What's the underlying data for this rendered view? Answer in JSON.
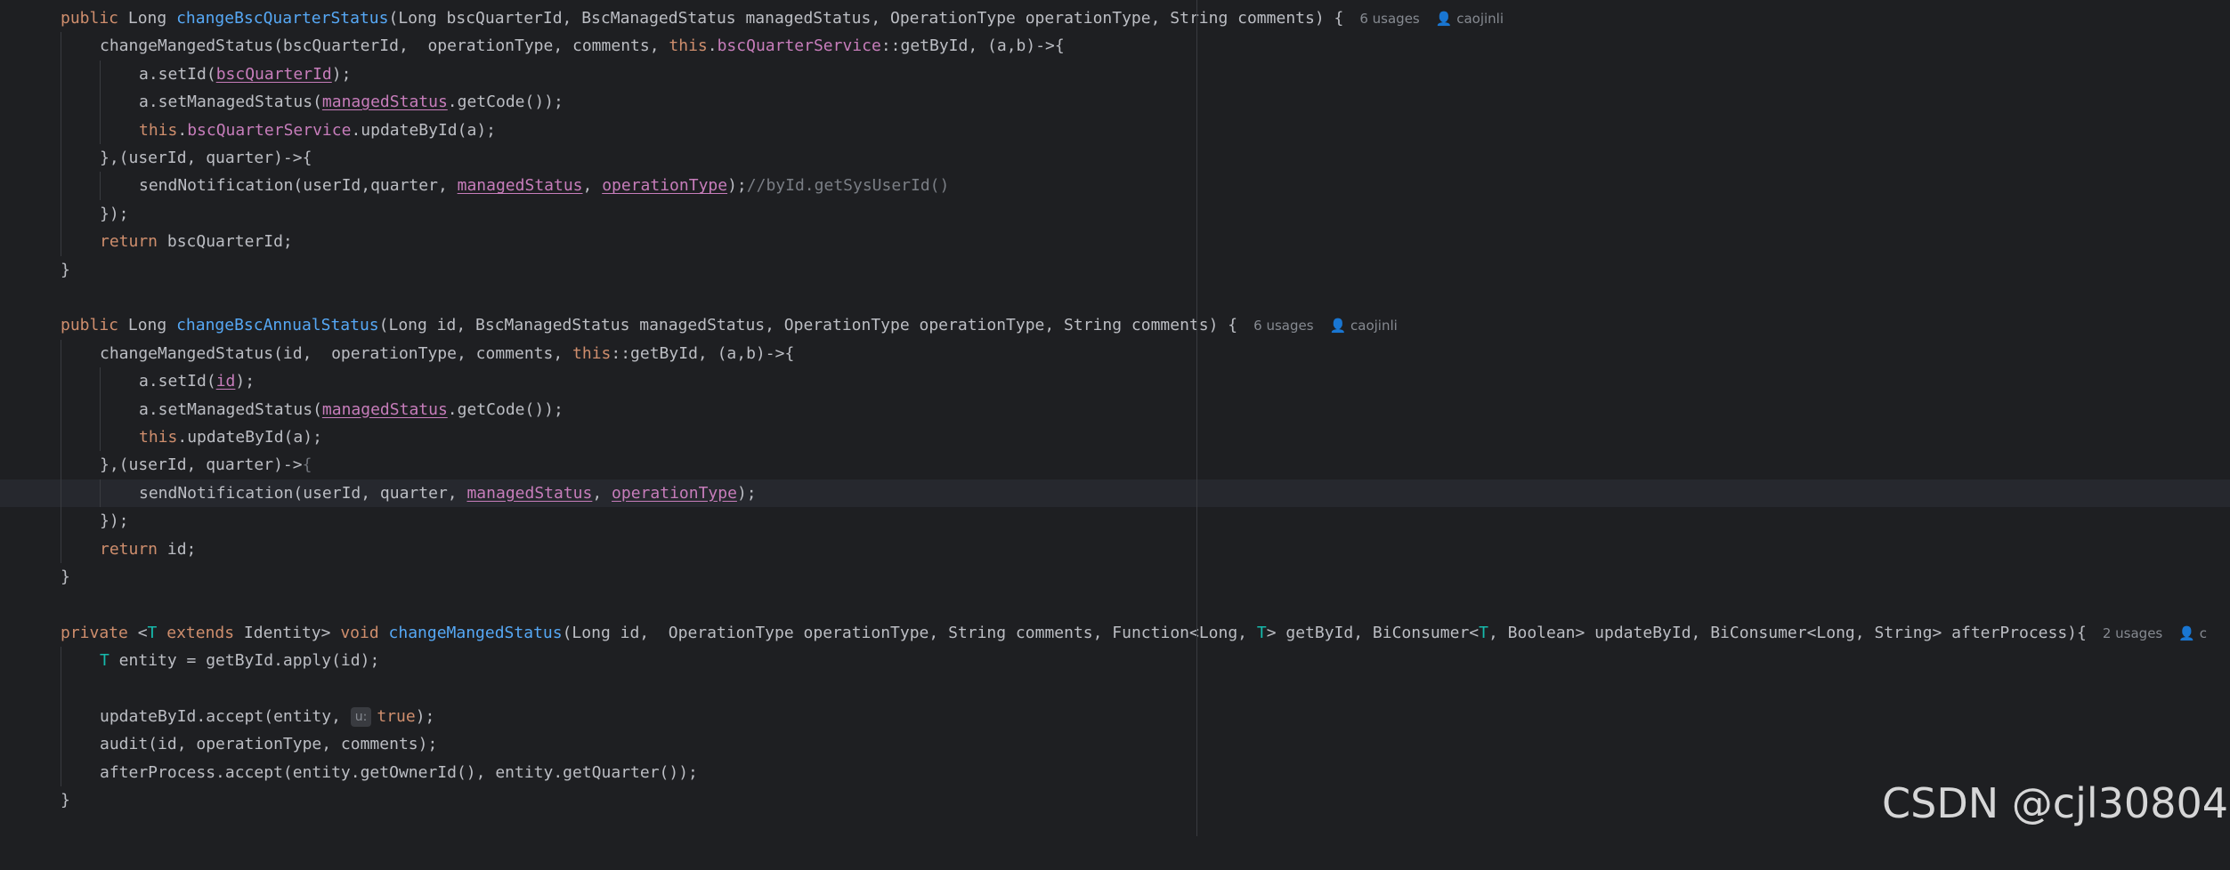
{
  "hints": {
    "usages_6": "6 usages",
    "usages_2": "2 usages",
    "author": "caojinli",
    "author_trunc": "c",
    "person_glyph": "👤"
  },
  "inlay_hint": "u:",
  "watermark": "CSDN @cjl30804",
  "colors": {
    "background": "#1e1f22",
    "keyword": "#cf8e6d",
    "function": "#56a8f5",
    "field": "#c77dbb",
    "type_param": "#16baac",
    "comment": "#7a7e85",
    "text": "#bcbec4"
  },
  "code": {
    "l0": {
      "a": "public",
      "b": " Long ",
      "c": "changeBscQuarterStatus",
      "d": "(Long bscQuarterId, BscManagedStatus managedStatus, OperationType operationType, String comments) {"
    },
    "l1": {
      "a": "changeMangedStatus(bscQuarterId,  operationType, comments, ",
      "b": "this",
      "c": ".",
      "d": "bscQuarterService",
      "e": "::getById, (a,b)->{"
    },
    "l2": {
      "a": "a.setId(",
      "b": "bscQuarterId",
      "c": ");"
    },
    "l3": {
      "a": "a.setManagedStatus(",
      "b": "managedStatus",
      "c": ".getCode());"
    },
    "l4": {
      "a": "this",
      "b": ".",
      "c": "bscQuarterService",
      "d": ".updateById(a);"
    },
    "l5": {
      "a": "},(userId, quarter)->{"
    },
    "l6": {
      "a": "sendNotification(userId,quarter, ",
      "b": "managedStatus",
      "c": ", ",
      "d": "operationType",
      "e": ");",
      "f": "//byId.getSysUserId()"
    },
    "l7": {
      "a": "});"
    },
    "l8": {
      "a": "return",
      "b": " bscQuarterId;"
    },
    "l9": {
      "a": "}"
    },
    "l11": {
      "a": "public",
      "b": " Long ",
      "c": "changeBscAnnualStatus",
      "d": "(Long id, BscManagedStatus managedStatus, OperationType operationType, String comments) {"
    },
    "l12": {
      "a": "changeMangedStatus(id,  operationType, comments, ",
      "b": "this",
      "c": "::getById, (a,b)->{"
    },
    "l13": {
      "a": "a.setId(",
      "b": "id",
      "c": ");"
    },
    "l14": {
      "a": "a.setManagedStatus(",
      "b": "managedStatus",
      "c": ".getCode());"
    },
    "l15": {
      "a": "this",
      "b": ".updateById(a);"
    },
    "l16": {
      "a": "},(userId, quarter)->",
      "b": "{"
    },
    "l17": {
      "a": "sendNotification(userId, quarter, ",
      "b": "managedStatus",
      "c": ", ",
      "d": "operationType",
      "e": ");"
    },
    "l18": {
      "a": "});"
    },
    "l19": {
      "a": "return",
      "b": " id;"
    },
    "l20": {
      "a": "}"
    },
    "l22": {
      "a": "private",
      "b": " <",
      "c": "T",
      "d": " ",
      "e": "extends",
      "f": " Identity> ",
      "g": "void",
      "h": " ",
      "i": "changeMangedStatus",
      "j": "(Long id,  OperationType operationType, String comments, Function<Long, ",
      "k": "T",
      "l": "> getById, BiConsumer<",
      "m": "T",
      "n": ", Boolean> updateById, BiConsumer<Long, String> afterProcess){"
    },
    "l23": {
      "a": "T",
      "b": " entity = getById.apply(id);"
    },
    "l25": {
      "a": "updateById.accept(entity, ",
      "b": "true",
      "c": ");"
    },
    "l26": {
      "a": "audit(id, operationType, comments);"
    },
    "l27": {
      "a": "afterProcess.accept(entity.getOwnerId(), entity.getQuarter());"
    },
    "l28": {
      "a": "}"
    }
  }
}
